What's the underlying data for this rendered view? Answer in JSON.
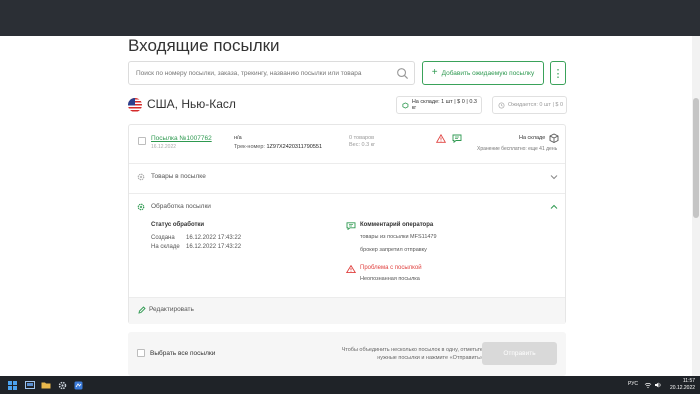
{
  "page": {
    "title": "Входящие посылки"
  },
  "search": {
    "placeholder": "Поиск по номеру посылки, заказа, трекингу, названию посылки или товара"
  },
  "toolbar": {
    "add_expected_label": "Добавить ожидаемую посылку",
    "more_label": "⋮"
  },
  "warehouse": {
    "name": "США, Нью-Касл",
    "in_stock": "На складе: 1 шт | $ 0 | 0.3 кг",
    "expected": "Ожидается: 0 шт | $ 0"
  },
  "package": {
    "number": "Посылка №1007762",
    "date": "16.12.2022",
    "name": "н/а",
    "track_label": "Трек-номер:",
    "track_number": "1Z97X2420311790551",
    "goods": "0 товаров",
    "weight": "Вес: 0.3 кг",
    "status": "На складе",
    "storage": "Хранение бесплатно: еще 41 день"
  },
  "sections": {
    "goods_label": "Товары в посылке",
    "processing_label": "Обработка посылки"
  },
  "processing": {
    "status_title": "Статус обработки",
    "rows": [
      {
        "label": "Создана",
        "value": "16.12.2022 17:43:22"
      },
      {
        "label": "На складе",
        "value": "16.12.2022 17:43:22"
      }
    ],
    "operator_title": "Комментарий оператора",
    "operator_lines": [
      "товары из посылки MFS11479",
      "брокер запретил отправку"
    ],
    "problem_title": "Проблема с посылкой",
    "problem_text": "Неопознанная посылка"
  },
  "edit_label": "Редактировать",
  "bulk": {
    "select_all": "Выбрать все посылки",
    "hint": "Чтобы объединить несколько посылок в одну, отметьте нужные посылки и нажмите «Отправить»",
    "send_label": "Отправить"
  },
  "taskbar": {
    "lang": "РУС",
    "time": "11:57",
    "date": "20.12.2022"
  },
  "colors": {
    "accent": "#2e9950",
    "error": "#e0413f",
    "topbar": "#2b2f35",
    "taskbar": "#1f2328"
  }
}
